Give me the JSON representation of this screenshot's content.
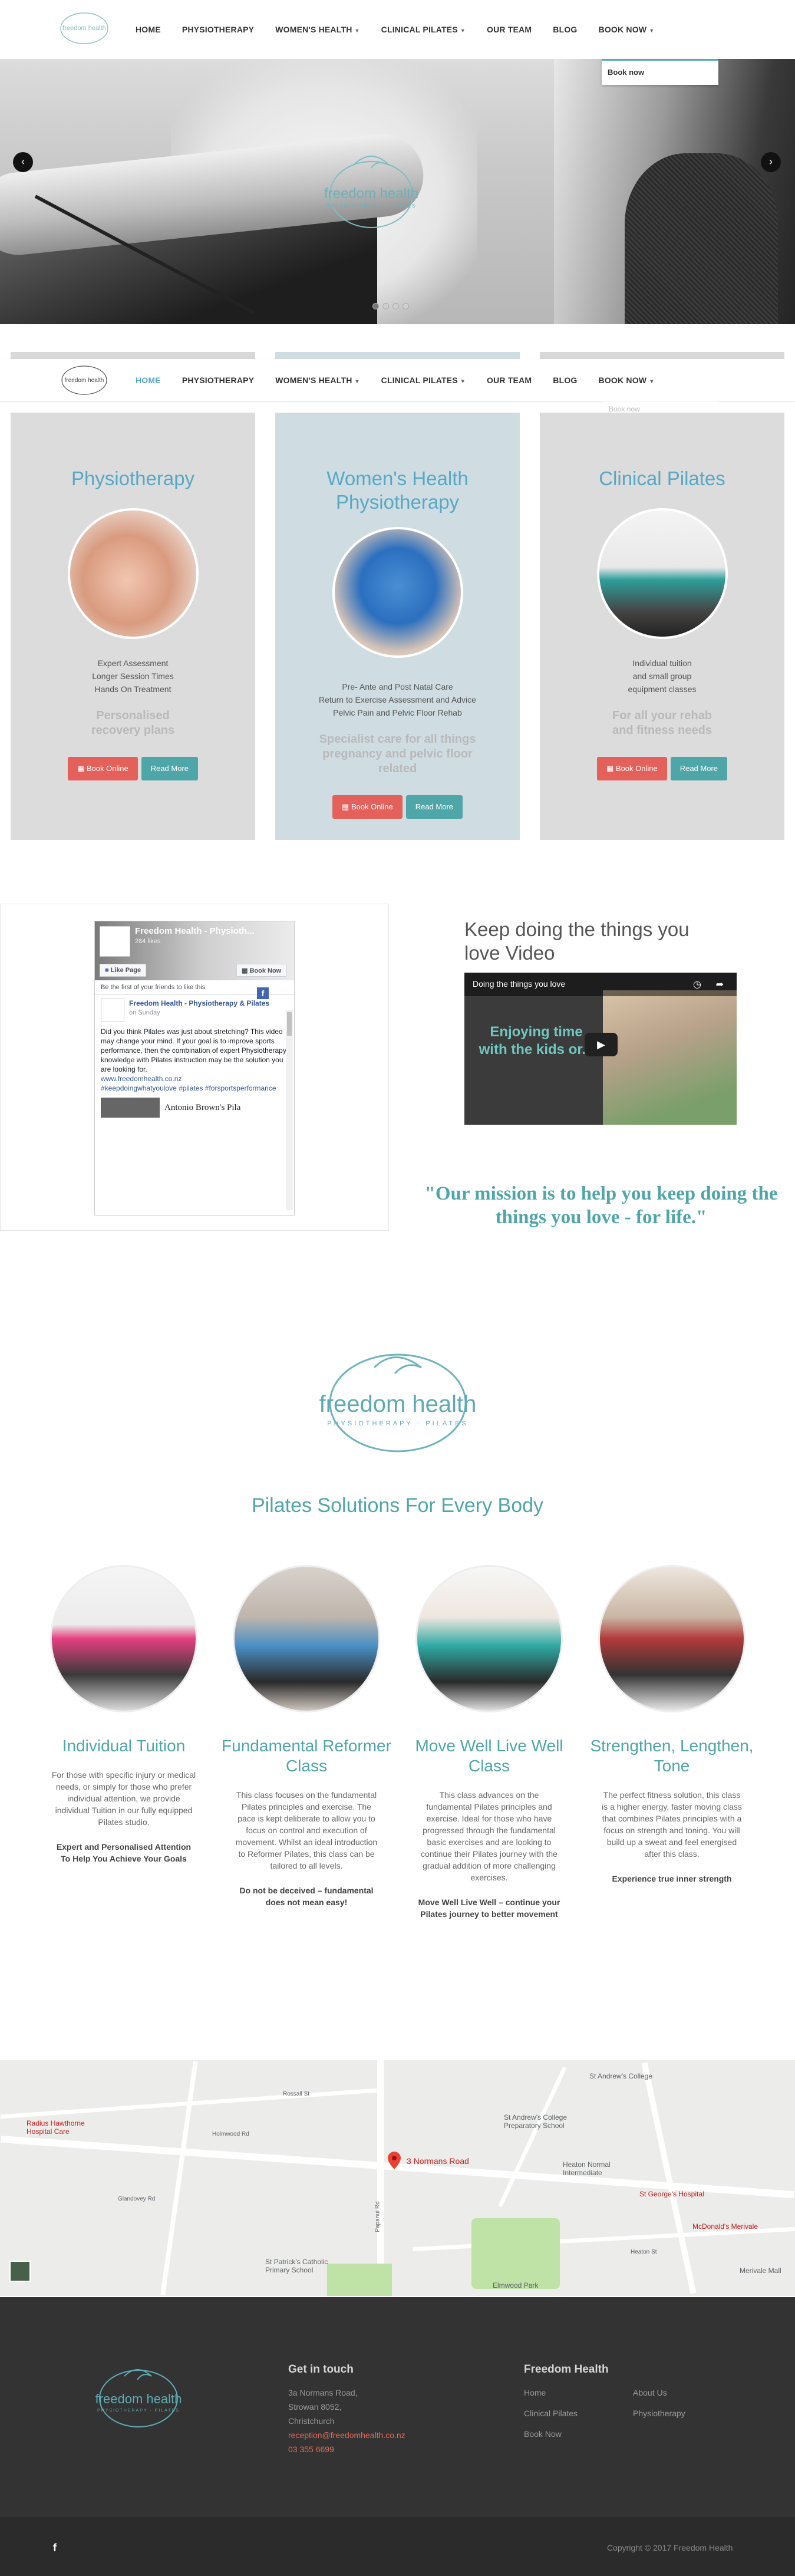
{
  "nav": {
    "logo_text": "freedom health",
    "logo_sub": "PHYSIOTHERAPY · PILATES",
    "items": [
      {
        "label": "HOME"
      },
      {
        "label": "PHYSIOTHERAPY"
      },
      {
        "label": "WOMEN'S HEALTH"
      },
      {
        "label": "CLINICAL PILATES"
      },
      {
        "label": "OUR TEAM"
      },
      {
        "label": "BLOG"
      },
      {
        "label": "BOOK NOW"
      }
    ],
    "dropdown_item": "Book now",
    "dropdown_item_ghost": "Book now"
  },
  "hero": {
    "logo_text": "freedom health",
    "logo_sub": "PHYSIOTHERAPY · PILATES",
    "prev": "‹",
    "next": "›",
    "slides": 4,
    "active_slide": 1
  },
  "services": [
    {
      "title": "Physiotherapy",
      "list": [
        "Expert Assessment",
        "Longer Session Times",
        "Hands On Treatment"
      ],
      "tagline": "Personalised recovery plans",
      "book": "Book Online",
      "more": "Read More"
    },
    {
      "title": "Women's Health Physiotherapy",
      "list": [
        "Pre- Ante and Post Natal Care",
        "Return to Exercise Assessment and Advice",
        "Pelvic Pain and Pelvic Floor Rehab"
      ],
      "tagline": "Specialist care for all things pregnancy and pelvic floor related",
      "book": "Book Online",
      "more": "Read More"
    },
    {
      "title": "Clinical Pilates",
      "list": [
        "Individual tuition",
        "and small group",
        "equipment classes"
      ],
      "tagline": "For all your rehab and fitness needs",
      "book": "Book Online",
      "more": "Read More"
    }
  ],
  "facebook": {
    "page_name": "Freedom Health - Physioth...",
    "likes": "284 likes",
    "like_btn": "Like Page",
    "book_btn": "Book Now",
    "first_friend": "Be the first of your friends to like this",
    "post_author": "Freedom Health - Physiotherapy & Pilates",
    "post_time": "on Sunday",
    "post_text": "Did you think Pilates was just about stretching? This video may change your mind. If your goal is to improve sports performance, then the combination of expert Physiotherapy knowledge with Pilates instruction may be the solution you are looking for.",
    "post_link": "www.freedomhealth.co.nz",
    "post_tags": "#keepdoingwhatyoulove #pilates #forsportsperformance",
    "next_post": "Antonio Brown's Pila"
  },
  "video": {
    "heading": "Keep doing the things you love Video",
    "title": "Doing the things you love",
    "overlay": "Enjoying time with the kids or..."
  },
  "mission": "\"Our mission is to help you keep doing the things you love - for life.\"",
  "pilates": {
    "logo_text": "freedom health",
    "logo_sub": "PHYSIOTHERAPY · PILATES",
    "title": "Pilates Solutions For Every Body",
    "cards": [
      {
        "title": "Individual Tuition",
        "text": "For those with specific injury or medical needs, or simply for those who prefer individual attention, we provide individual Tuition in our fully equipped Pilates studio.",
        "strong": "Expert and Personalised Attention To Help You Achieve Your Goals"
      },
      {
        "title": "Fundamental Reformer Class",
        "text": "This class focuses on the fundamental Pilates principles and exercise. The pace is kept deliberate to allow you to focus on control and execution of movement. Whilst an ideal introduction to Reformer Pilates, this class can be tailored to all levels.",
        "strong": "Do not be deceived – fundamental does not mean easy!"
      },
      {
        "title": "Move Well Live Well Class",
        "text": "This class advances on the fundamental Pilates principles and exercise. Ideal for those who have progressed through the fundamental basic exercises and are looking to continue their Pilates journey with the gradual addition of more challenging exercises.",
        "strong": "Move Well Live Well – continue your Pilates journey to better movement"
      },
      {
        "title": "Strengthen, Lengthen, Tone",
        "text": "The perfect fitness solution, this class is a higher energy, faster moving class that combines Pilates principles with a focus on strength and toning. You will build up a sweat and feel energised after this class.",
        "strong": "Experience true inner strength"
      }
    ]
  },
  "map": {
    "pin_label": "3 Normans Road",
    "labels": [
      "St Andrew's College",
      "St Andrew's College Preparatory School",
      "Radius Hawthorne Hospital Care",
      "Heaton Normal Intermediate",
      "St George's Hospital",
      "McDonald's Merivale",
      "St Patrick's Catholic Primary School",
      "Elmwood Park",
      "Merivale Mall",
      "Rossall St",
      "Papanui Rd",
      "Heaton St",
      "Glandovey Rd",
      "Holmwood Rd"
    ]
  },
  "footer": {
    "logo_text": "freedom health",
    "logo_sub": "PHYSIOTHERAPY · PILATES",
    "contact_heading": "Get in touch",
    "address1": "3a Normans Road,",
    "address2": "Strowan 8052,",
    "address3": "Christchurch",
    "email": "reception@freedomhealth.co.nz",
    "phone": "03 355 6699",
    "links_heading": "Freedom Health",
    "links": [
      "Home",
      "About Us",
      "Clinical Pilates",
      "Physiotherapy",
      "Book Now"
    ],
    "copyright": "Copyright © 2017 Freedom Health",
    "social": "f"
  },
  "colors": {
    "brand": "#59a8c3",
    "teal_button": "#4fa6a9",
    "red_button": "#e4605b",
    "footer": "#333333"
  }
}
